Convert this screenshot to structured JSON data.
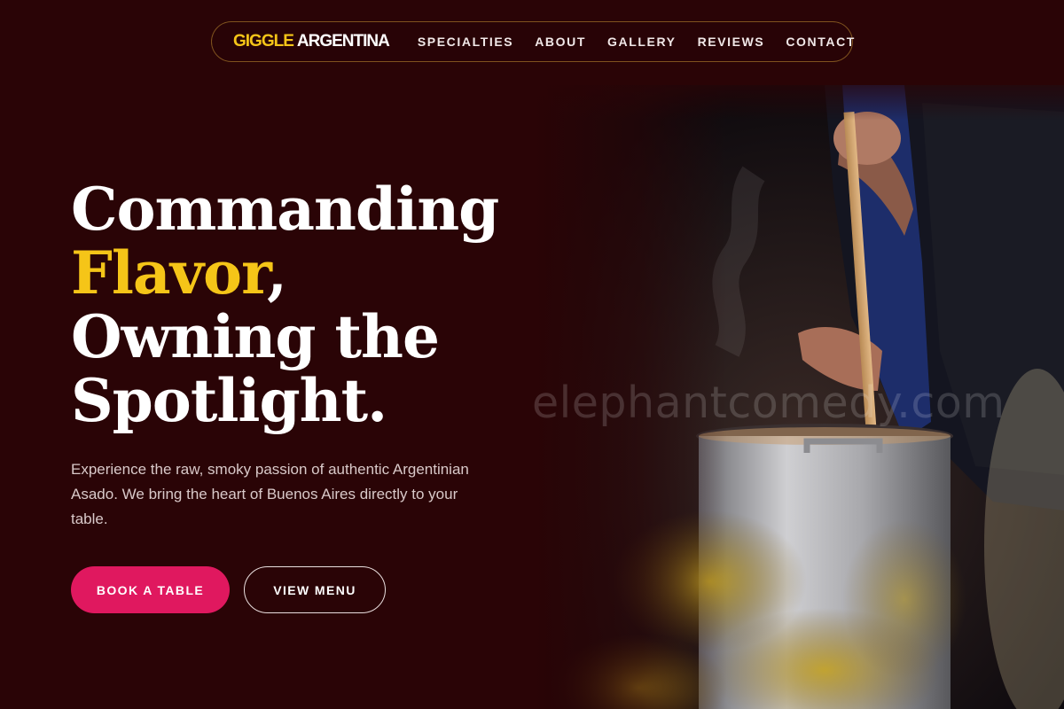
{
  "brand": {
    "part1": "GIGGLE",
    "part2": "ARGENTINA"
  },
  "nav": {
    "items": [
      "SPECIALTIES",
      "ABOUT",
      "GALLERY",
      "REVIEWS",
      "CONTACT"
    ]
  },
  "hero": {
    "line1": "Commanding",
    "line2_accent": "Flavor",
    "line2_rest": ",",
    "line3": "Owning the",
    "line4": "Spotlight.",
    "lead": "Experience the raw, smoky passion of authentic Argentinian Asado. We bring the heart of Buenos Aires directly to your table.",
    "primary_cta": "BOOK A TABLE",
    "secondary_cta": "VIEW MENU"
  },
  "image": {
    "watermark": "elephantcomedy.com"
  },
  "colors": {
    "background": "#2a0406",
    "accent_yellow": "#f5c518",
    "primary_pink": "#e0185f"
  }
}
